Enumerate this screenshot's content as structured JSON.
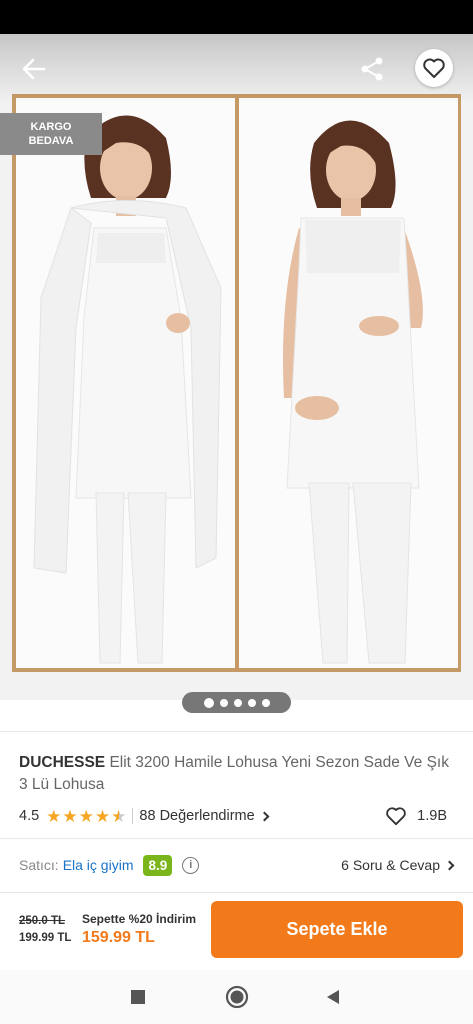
{
  "hero": {
    "badge_line1": "KARGO",
    "badge_line2": "BEDAVA",
    "image_count": 5,
    "active_image": 1
  },
  "product": {
    "brand": "DUCHESSE",
    "name": "Elit 3200 Hamile Lohusa Yeni Sezon Sade Ve Şık 3 Lü Lohusa",
    "rating": "4.5",
    "rating_value": 4.5,
    "reviews": "88 Değerlendirme",
    "likes": "1.9B"
  },
  "seller": {
    "label": "Satıcı:",
    "name": "Ela iç giyim",
    "score": "8.9",
    "qa": "6 Soru & Cevap"
  },
  "pricing": {
    "old_price": "250.0 TL",
    "price": "199.99 TL",
    "promo": "Sepette %20 İndirim",
    "final_price": "159.99 TL",
    "add_to_cart": "Sepete Ekle"
  },
  "colors": {
    "accent": "#f27a1a",
    "seller_score": "#7bb51c",
    "link": "#1a73c9",
    "frame": "#c69a66"
  },
  "icons": [
    "back-arrow-icon",
    "share-icon",
    "heart-icon",
    "star-icon",
    "info-icon",
    "chevron-right-icon",
    "nav-square-icon",
    "nav-home-icon",
    "nav-back-icon"
  ]
}
